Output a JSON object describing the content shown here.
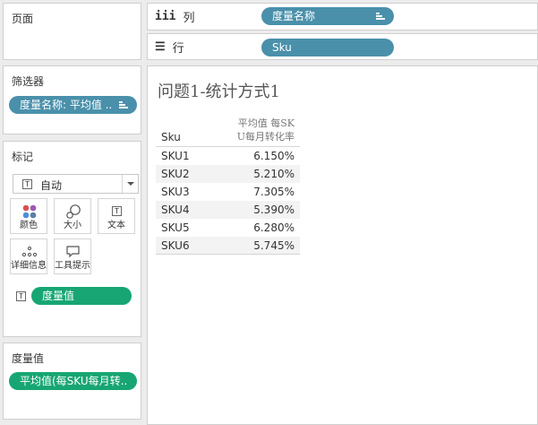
{
  "pages_panel": {
    "title": "页面"
  },
  "columns_shelf": {
    "label": "列",
    "icon": "columns-icon",
    "pill": "度量名称"
  },
  "rows_shelf": {
    "label": "行",
    "icon": "rows-icon",
    "pill": "Sku"
  },
  "filters_panel": {
    "title": "筛选器",
    "pill": "度量名称: 平均值 .."
  },
  "marks_panel": {
    "title": "标记",
    "mark_type": "自动",
    "buttons": [
      {
        "label": "颜色",
        "icon": "color-icon"
      },
      {
        "label": "大小",
        "icon": "size-icon"
      },
      {
        "label": "文本",
        "icon": "text-icon"
      },
      {
        "label": "详细信息",
        "icon": "detail-icon"
      },
      {
        "label": "工具提示",
        "icon": "tooltip-icon"
      }
    ],
    "field_pill": "度量值",
    "field_icon_text": "T"
  },
  "measure_values_panel": {
    "title": "度量值",
    "pill": "平均值(每SKU每月转.."
  },
  "view": {
    "title": "问题1-统计方式1",
    "table": {
      "row_header": "Sku",
      "col_header_line1": "平均值 每SK",
      "col_header_line2": "U每月转化率",
      "rows": [
        {
          "sku": "SKU1",
          "value": "6.150%"
        },
        {
          "sku": "SKU2",
          "value": "5.210%"
        },
        {
          "sku": "SKU3",
          "value": "7.305%"
        },
        {
          "sku": "SKU4",
          "value": "5.390%"
        },
        {
          "sku": "SKU5",
          "value": "6.280%"
        },
        {
          "sku": "SKU6",
          "value": "5.745%"
        }
      ]
    }
  },
  "colors": {
    "pill_blue": "#4a90ab",
    "pill_green": "#17a673"
  }
}
